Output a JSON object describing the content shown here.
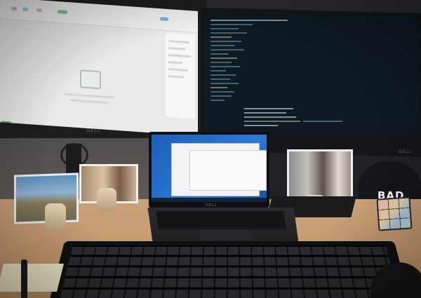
{
  "scene": {
    "brand_left_monitor": "DELL",
    "brand_right_monitor": "DELL",
    "brand_laptop": "DELL",
    "cube_text": "BAD"
  },
  "colors": {
    "desk": "#c79a6e",
    "laptop_wallpaper": "#2a7bd6",
    "code_bg": "#0f1a24"
  }
}
